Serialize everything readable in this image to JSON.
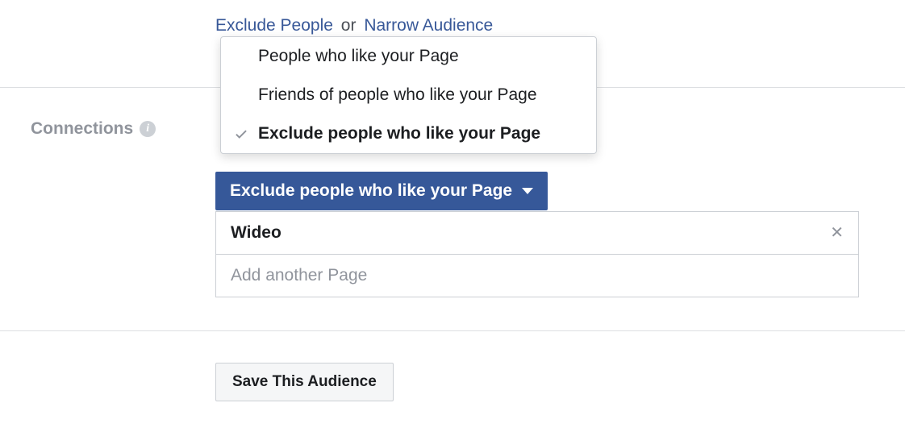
{
  "top_links": {
    "exclude": "Exclude People",
    "or": "or",
    "narrow": "Narrow Audience"
  },
  "section": {
    "label": "Connections"
  },
  "dropdown": {
    "options": [
      {
        "label": "People who like your Page",
        "selected": false
      },
      {
        "label": "Friends of people who like your Page",
        "selected": false
      },
      {
        "label": "Exclude people who like your Page",
        "selected": true
      }
    ],
    "selected_label": "Exclude people who like your Page"
  },
  "tokens": {
    "items": [
      {
        "label": "Wideo"
      }
    ],
    "add_placeholder": "Add another Page"
  },
  "save_button": "Save This Audience"
}
